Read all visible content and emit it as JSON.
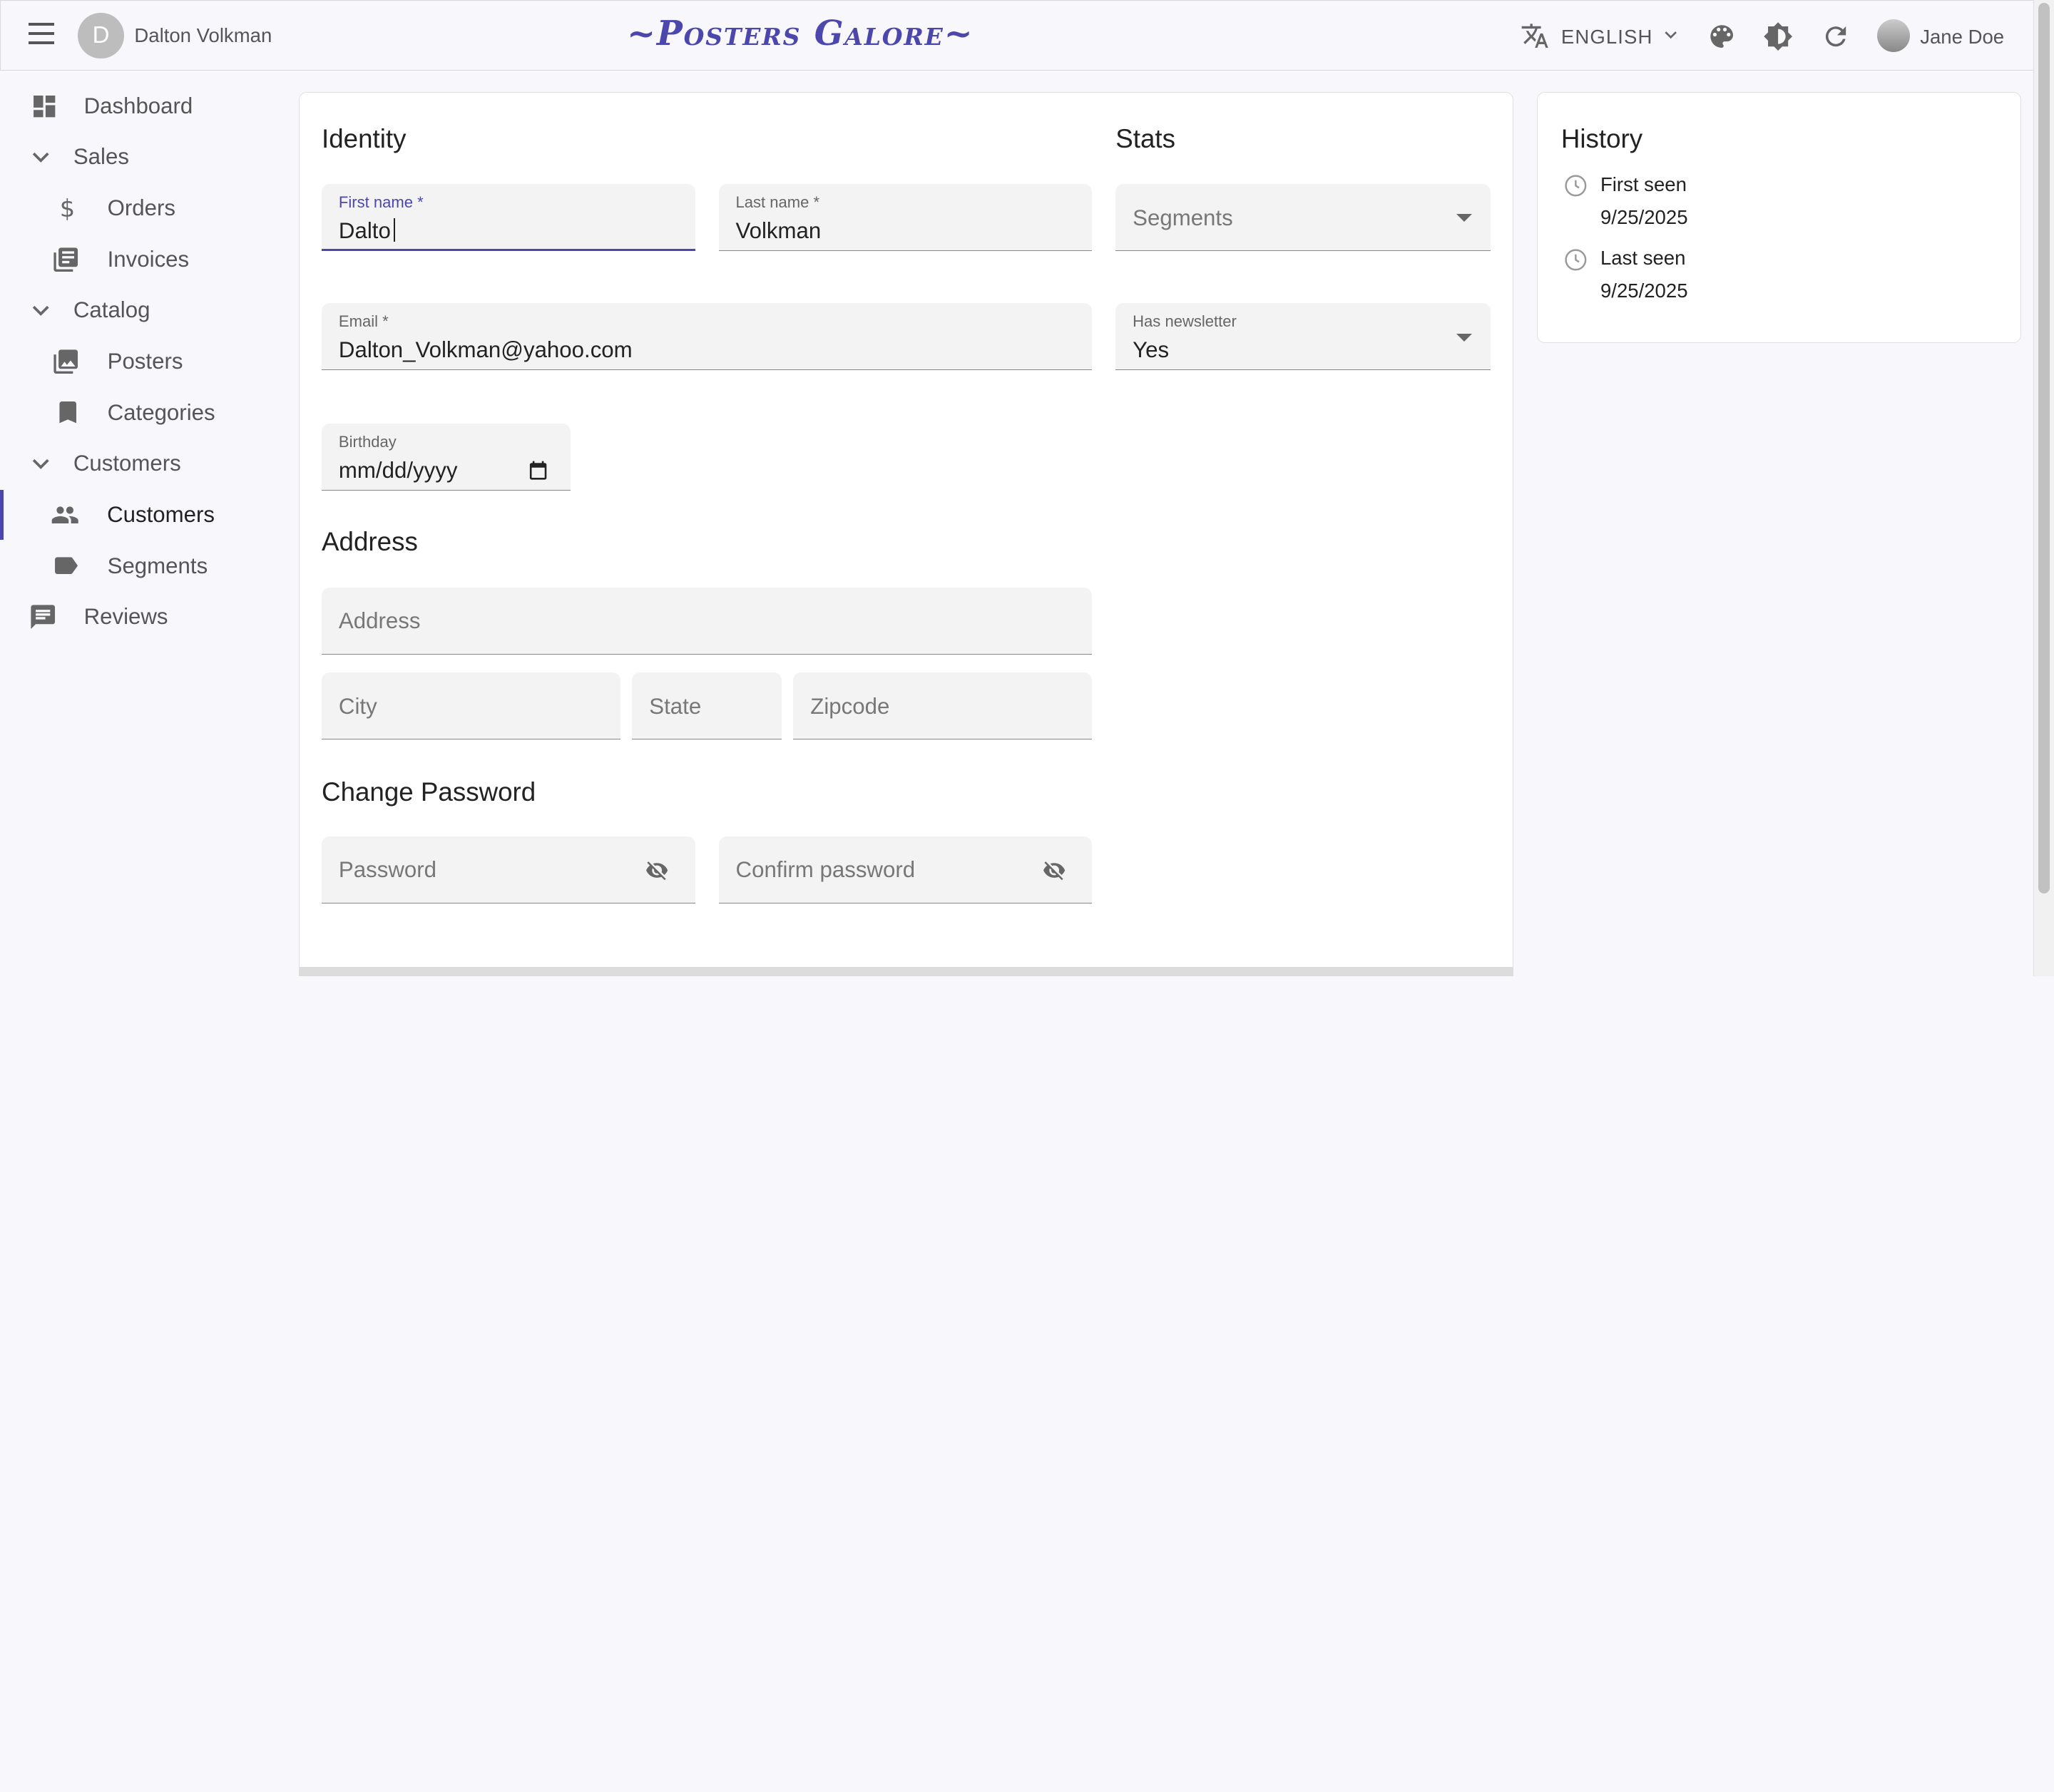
{
  "header": {
    "record_avatar_letter": "D",
    "record_name": "Dalton Volkman",
    "logo": "~Posters Galore~",
    "language": "ENGLISH",
    "user_name": "Jane Doe"
  },
  "sidebar": {
    "items": [
      {
        "label": "Dashboard",
        "icon": "dashboard-icon"
      },
      {
        "label": "Sales",
        "icon": "chevron-down-icon"
      },
      {
        "label": "Orders",
        "icon": "dollar-icon"
      },
      {
        "label": "Invoices",
        "icon": "invoices-icon"
      },
      {
        "label": "Catalog",
        "icon": "chevron-down-icon"
      },
      {
        "label": "Posters",
        "icon": "image-icon"
      },
      {
        "label": "Categories",
        "icon": "bookmark-icon"
      },
      {
        "label": "Customers",
        "icon": "chevron-down-icon"
      },
      {
        "label": "Customers",
        "icon": "people-icon"
      },
      {
        "label": "Segments",
        "icon": "label-icon"
      },
      {
        "label": "Reviews",
        "icon": "comment-icon"
      }
    ]
  },
  "form": {
    "identity_heading": "Identity",
    "first_name_label": "First name *",
    "first_name_value": "Dalto",
    "last_name_label": "Last name *",
    "last_name_value": "Volkman",
    "email_label": "Email *",
    "email_value": "Dalton_Volkman@yahoo.com",
    "birthday_label": "Birthday",
    "birthday_value": "mm/dd/yyyy",
    "address_heading": "Address",
    "address_placeholder": "Address",
    "city_placeholder": "City",
    "state_placeholder": "State",
    "zipcode_placeholder": "Zipcode",
    "password_heading": "Change Password",
    "password_placeholder": "Password",
    "confirm_password_placeholder": "Confirm password",
    "stats_heading": "Stats",
    "segments_placeholder": "Segments",
    "newsletter_label": "Has newsletter",
    "newsletter_value": "Yes"
  },
  "history": {
    "heading": "History",
    "first_seen_label": "First seen",
    "first_seen_value": "9/25/2025",
    "last_seen_label": "Last seen",
    "last_seen_value": "9/25/2025"
  },
  "colors": {
    "accent": "#4b47ad"
  }
}
